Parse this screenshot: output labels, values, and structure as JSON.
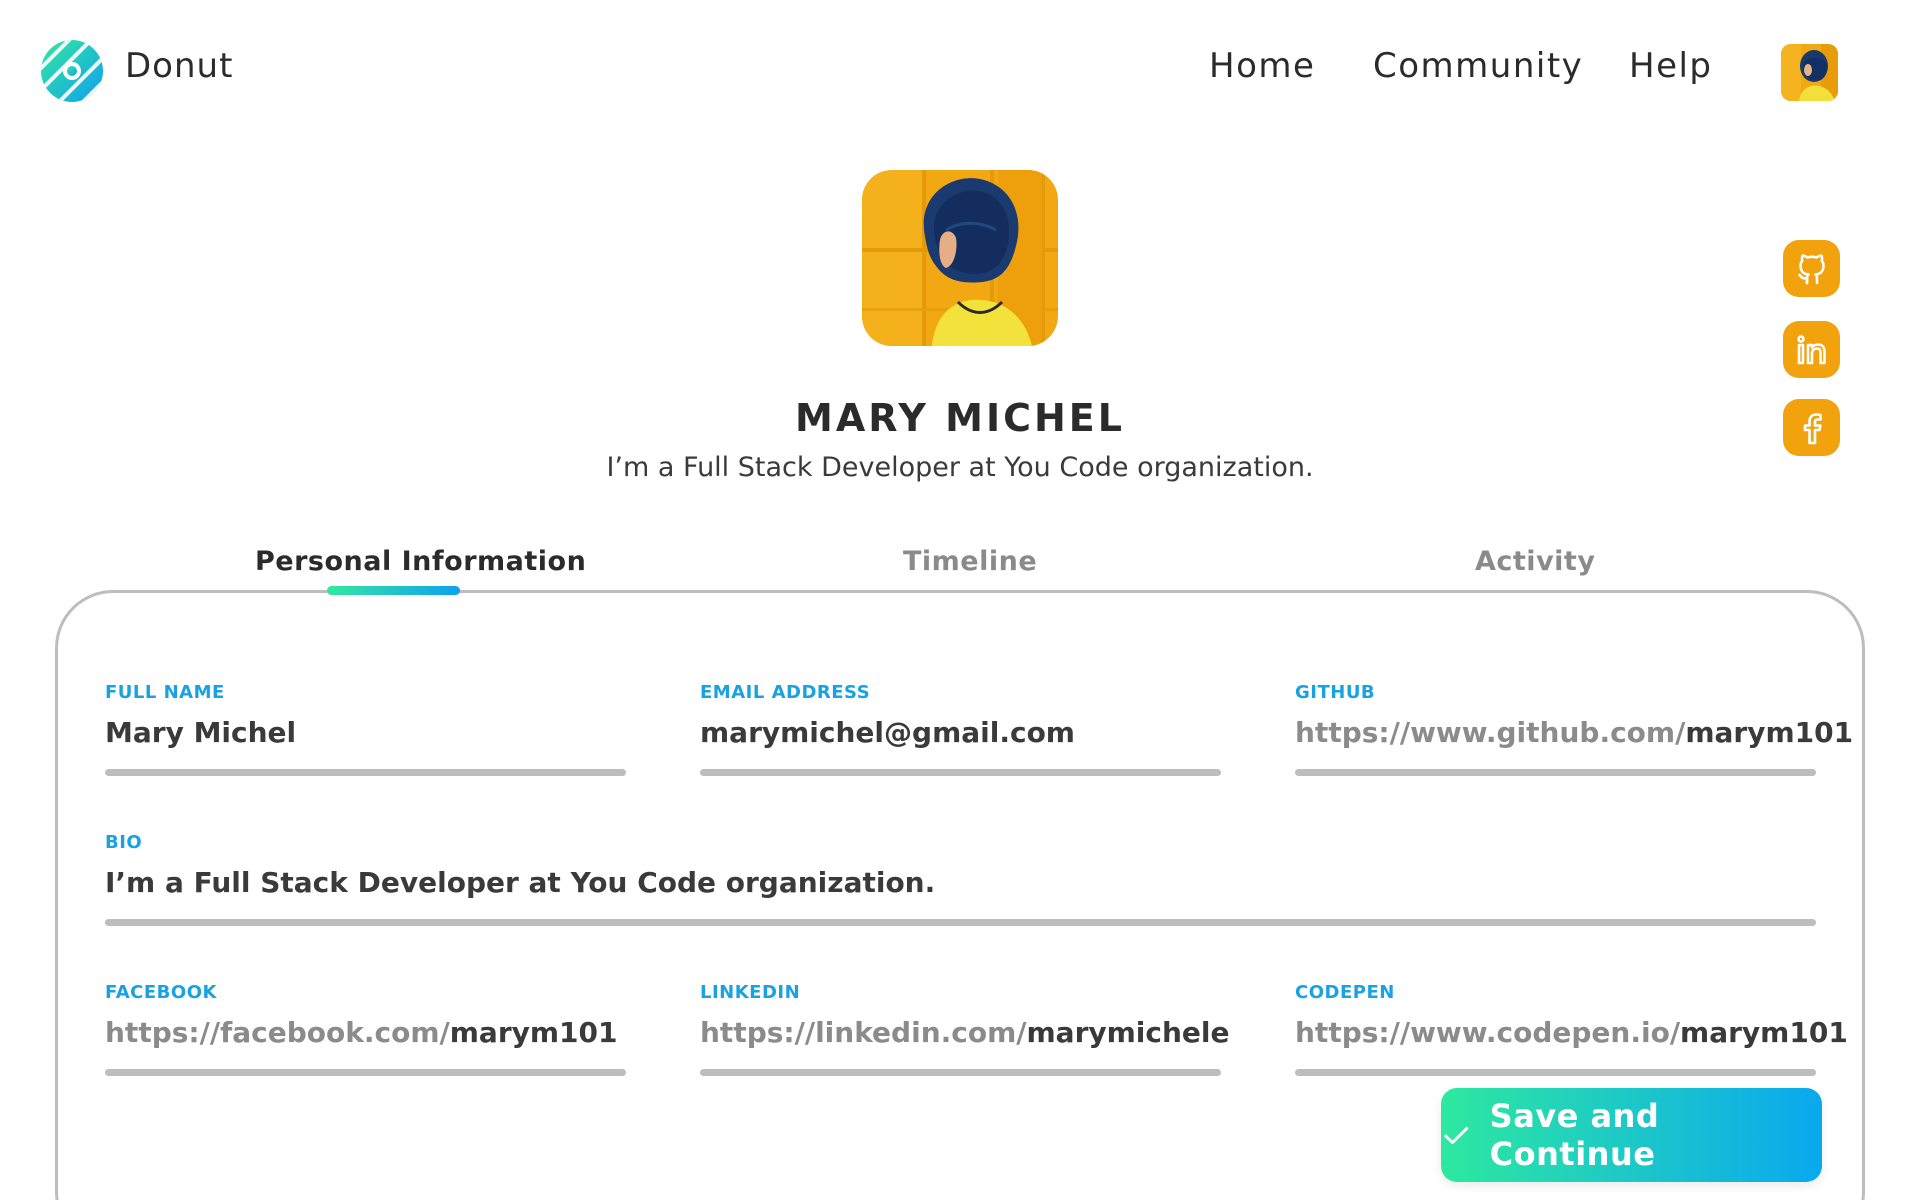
{
  "app": {
    "brand": "Donut",
    "logo_icon": "donut-icon",
    "accent_gradient": [
      "#34e89e",
      "#0fa0f0"
    ],
    "label_color": "#18a2e2",
    "social_color": "#f2a20c"
  },
  "nav": {
    "items": [
      {
        "label": "Home"
      },
      {
        "label": "Community"
      },
      {
        "label": "Help"
      }
    ],
    "avatar_icon": "user-avatar"
  },
  "profile": {
    "name": "MARY MICHEL",
    "tagline": "I’m a Full Stack Developer at You Code organization."
  },
  "social": [
    {
      "name": "github",
      "icon": "github-icon"
    },
    {
      "name": "linkedin",
      "icon": "linkedin-icon"
    },
    {
      "name": "facebook",
      "icon": "facebook-icon"
    }
  ],
  "tabs": [
    {
      "label": "Personal Information",
      "active": true
    },
    {
      "label": "Timeline",
      "active": false
    },
    {
      "label": "Activity",
      "active": false
    }
  ],
  "form": {
    "full_name": {
      "label": "FULL NAME",
      "value": "Mary Michel"
    },
    "email": {
      "label": "EMAIL ADDRESS",
      "value": "marymichel@gmail.com"
    },
    "github": {
      "label": "GITHUB",
      "prefix": "https://www.github.com/",
      "value": "marym101"
    },
    "bio": {
      "label": "BIO",
      "value": "I’m a Full Stack Developer at You Code organization."
    },
    "facebook": {
      "label": "FACEBOOK",
      "prefix": "https://facebook.com/",
      "value": "marym101"
    },
    "linkedin": {
      "label": "LINKEDIN",
      "prefix": "https://linkedin.com/",
      "value": "marymichele"
    },
    "codepen": {
      "label": "CODEPEN",
      "prefix": "https://www.codepen.io/",
      "value": "marym101"
    }
  },
  "actions": {
    "save_label": "Save and Continue",
    "save_icon": "check-icon"
  }
}
